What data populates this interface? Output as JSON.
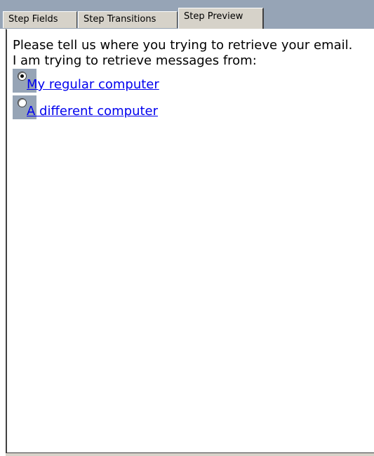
{
  "tabs": [
    {
      "label": "Step Fields",
      "active": false
    },
    {
      "label": "Step Transitions",
      "active": false
    },
    {
      "label": "Step Preview",
      "active": true
    }
  ],
  "preview": {
    "prompt": "Please tell us where you trying to retrieve your email.",
    "subprompt": "I am trying to retrieve messages from:",
    "options": [
      {
        "label": "My regular computer",
        "selected": true
      },
      {
        "label": "A different computer",
        "selected": false
      }
    ]
  },
  "colors": {
    "tabstrip_background": "#96a4b6",
    "tab_face": "#d6d2c9",
    "link": "#0000ee",
    "radio_highlight": "#96a4b6"
  },
  "icons": {
    "radio_selected": "radio-checked-icon",
    "radio_unselected": "radio-unchecked-icon"
  }
}
